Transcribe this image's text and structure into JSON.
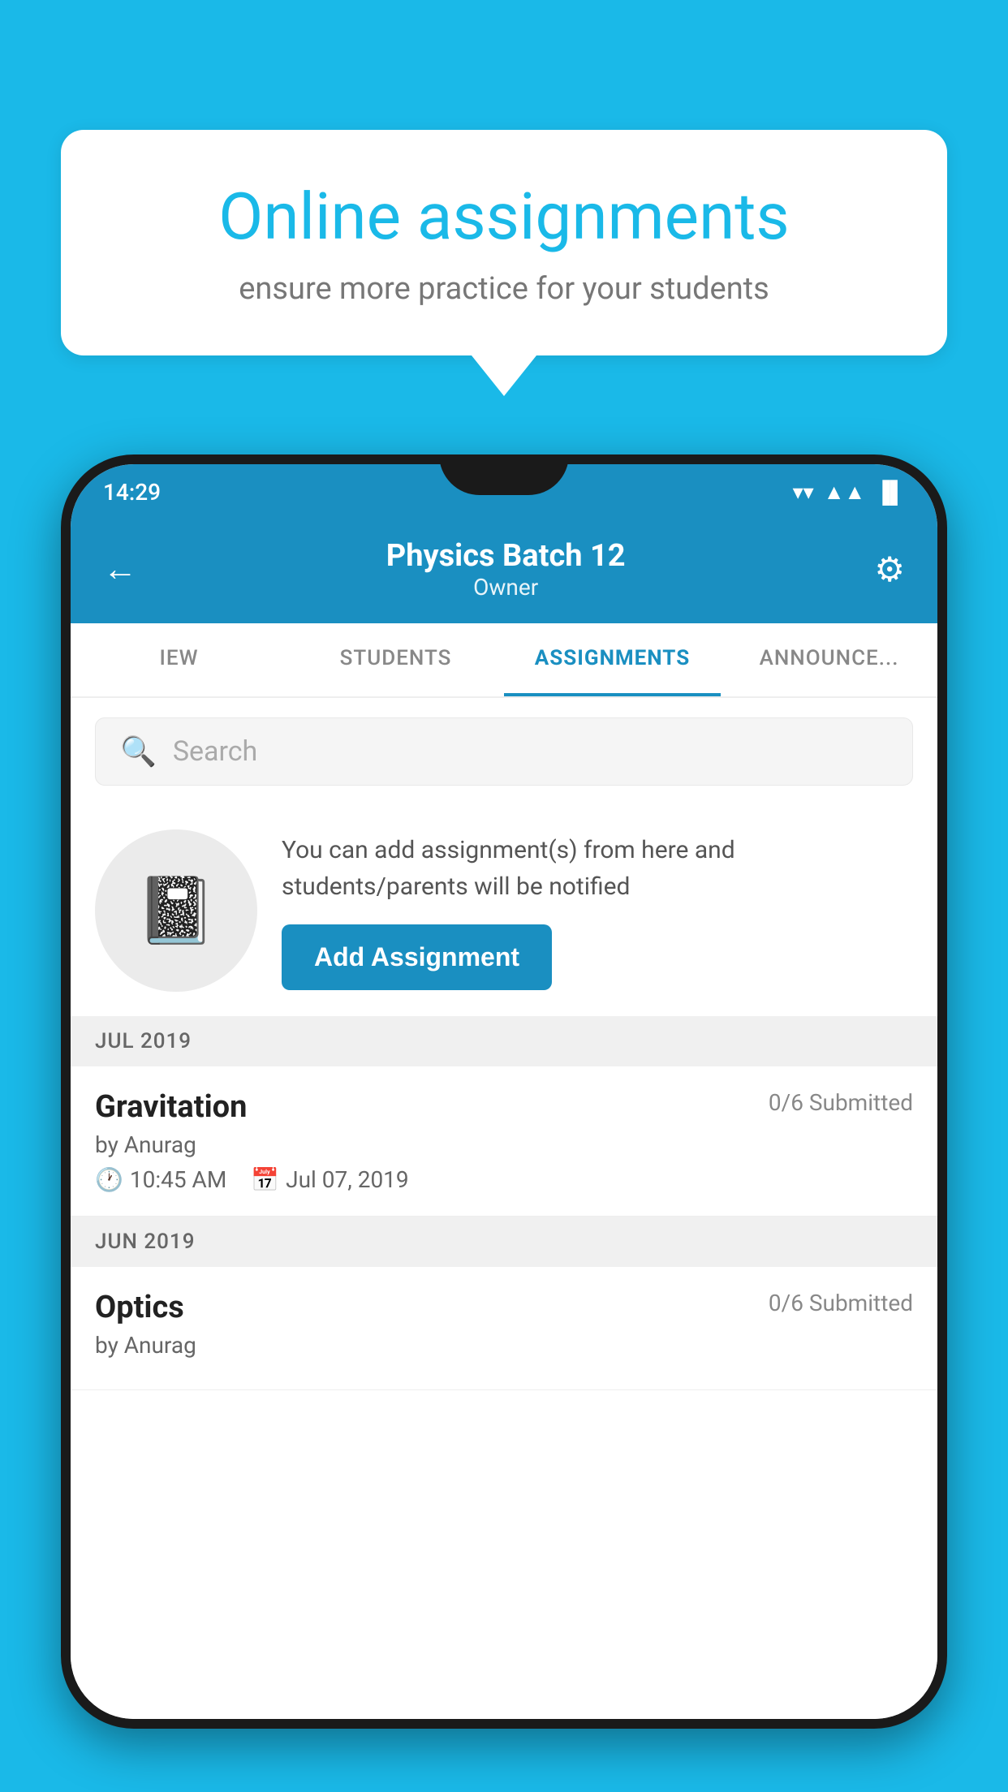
{
  "background_color": "#1ab9e8",
  "bubble": {
    "title": "Online assignments",
    "subtitle": "ensure more practice for your students"
  },
  "phone": {
    "status_bar": {
      "time": "14:29",
      "wifi": "▼",
      "signal": "▲",
      "battery": "▐"
    },
    "app_bar": {
      "title": "Physics Batch 12",
      "subtitle": "Owner",
      "back_label": "←",
      "settings_label": "⚙"
    },
    "tabs": [
      {
        "label": "IEW",
        "active": false
      },
      {
        "label": "STUDENTS",
        "active": false
      },
      {
        "label": "ASSIGNMENTS",
        "active": true
      },
      {
        "label": "ANNOUNCE...",
        "active": false
      }
    ],
    "search": {
      "placeholder": "Search"
    },
    "info_section": {
      "text": "You can add assignment(s) from here and students/parents will be notified",
      "button_label": "Add Assignment"
    },
    "assignment_groups": [
      {
        "month_label": "JUL 2019",
        "assignments": [
          {
            "name": "Gravitation",
            "submitted": "0/6 Submitted",
            "author": "by Anurag",
            "time": "10:45 AM",
            "date": "Jul 07, 2019"
          }
        ]
      },
      {
        "month_label": "JUN 2019",
        "assignments": [
          {
            "name": "Optics",
            "submitted": "0/6 Submitted",
            "author": "by Anurag",
            "time": "",
            "date": ""
          }
        ]
      }
    ]
  }
}
